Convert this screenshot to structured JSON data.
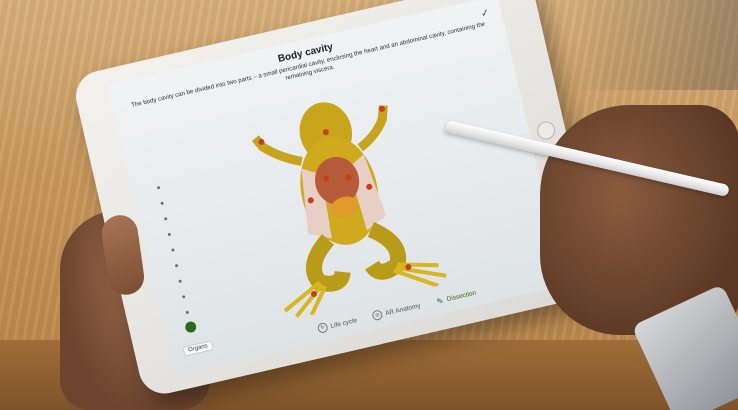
{
  "screen": {
    "title": "Body cavity",
    "description": "The body cavity can be divided into two parts – a small pericardial cavity, enclosing the heart and an abdominal cavity, containing the remaining viscera.",
    "check_icon": "checkmark-icon"
  },
  "sidebar": {
    "organs_label": "Organs"
  },
  "tabs": [
    {
      "label": "Life cycle",
      "icon": "lifecycle-icon",
      "active": false
    },
    {
      "label": "AR Anatomy",
      "icon": "ar-icon",
      "active": false
    },
    {
      "label": "Dissection",
      "icon": "scalpel-icon",
      "active": true
    }
  ],
  "colors": {
    "accent_green": "#2d6a1f",
    "frog_yellow": "#d4b21c",
    "marker_red": "#c2411c"
  }
}
